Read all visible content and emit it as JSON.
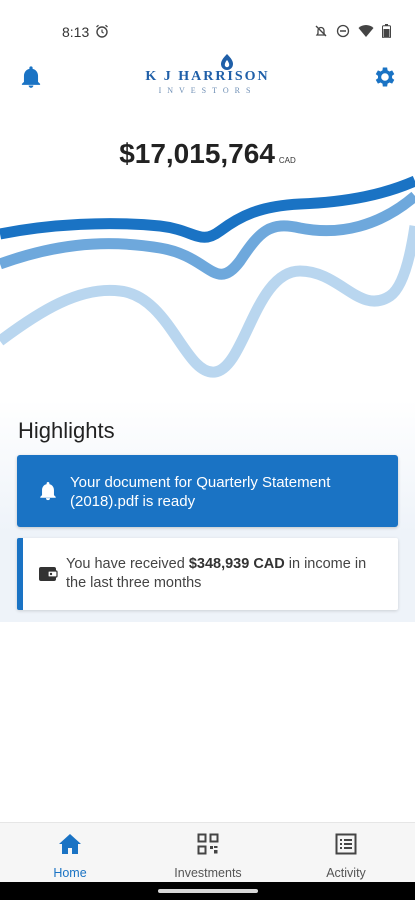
{
  "status_bar": {
    "time": "8:13"
  },
  "header": {
    "logo_name": "K J HARRISON",
    "logo_sub": "INVESTORS"
  },
  "portfolio": {
    "value": "$17,015,764",
    "currency": "CAD"
  },
  "highlights": {
    "title": "Highlights",
    "document_card": {
      "text": "Your document for Quarterly  Statement (2018).pdf is ready"
    },
    "income_card": {
      "prefix": "You have received ",
      "amount": "$348,939 CAD",
      "suffix": " in income in the last three months"
    }
  },
  "bottom_nav": {
    "items": [
      {
        "label": "Home",
        "icon": "home-icon",
        "active": true
      },
      {
        "label": "Investments",
        "icon": "investments-grid-icon",
        "active": false
      },
      {
        "label": "Activity",
        "icon": "activity-list-icon",
        "active": false
      }
    ]
  },
  "colors": {
    "brand_blue": "#1a73c4",
    "wave_dark": "#1a73c4",
    "wave_mid": "#6ea8dc",
    "wave_light": "#b9d6ef"
  }
}
